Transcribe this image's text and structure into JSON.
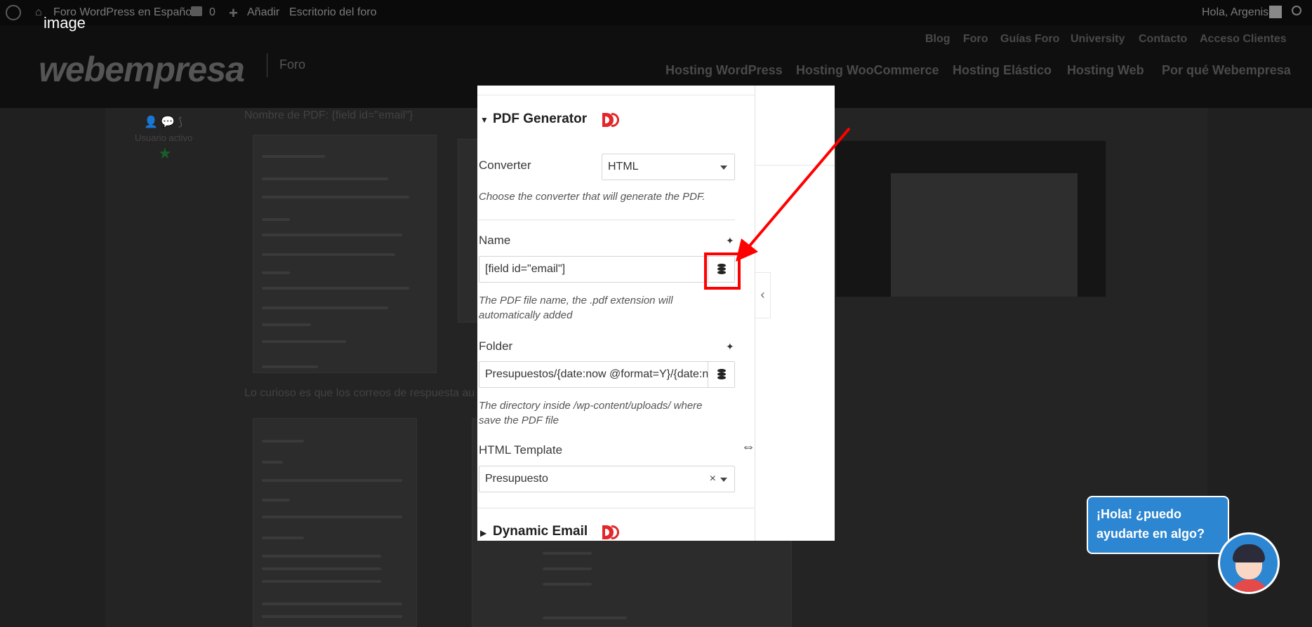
{
  "lightbox": {
    "title": "image"
  },
  "adminbar": {
    "site_name": "Foro WordPress en Español",
    "comments_count": "0",
    "add_label": "Añadir",
    "dashboard_label": "Escritorio del foro",
    "greeting": "Hola, Argenis"
  },
  "header": {
    "logo_text": "webempresa",
    "logo_section": "Foro",
    "top_links": [
      "Blog",
      "Foro",
      "Guías Foro",
      "University",
      "Contacto",
      "Acceso Clientes"
    ],
    "main_links": [
      "Hosting WordPress",
      "Hosting WooCommerce",
      "Hosting Elástico",
      "Hosting Web",
      "Por qué Webempresa"
    ]
  },
  "post": {
    "user_status": "Usuario activo",
    "text_1": "Nombre de PDF: {field id=\"email\"}",
    "text_2": "Lo curioso es que los correos de respuesta au"
  },
  "modal": {
    "pdf_section_title": "PDF Generator",
    "converter": {
      "label": "Converter",
      "value": "HTML",
      "hint": "Choose the converter that will generate the PDF."
    },
    "name": {
      "label": "Name",
      "value": "[field id=\"email\"]",
      "hint": "The PDF file name, the .pdf extension will automatically added"
    },
    "folder": {
      "label": "Folder",
      "value": "Presupuestos/{date:now @format=Y}/{date:now",
      "hint": "The directory inside /wp-content/uploads/ where save the PDF file"
    },
    "template": {
      "label": "HTML Template",
      "value": "Presupuesto",
      "clear": "×"
    },
    "email_section_title": "Dynamic Email"
  },
  "chat": {
    "bubble_text": "¡Hola! ¿puedo ayudarte en algo?"
  },
  "colors": {
    "annotation_red": "#ff0000",
    "chat_blue": "#2d86d1",
    "brand_red": "#e3262a"
  }
}
